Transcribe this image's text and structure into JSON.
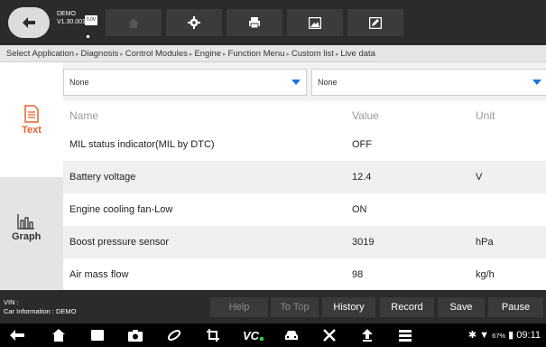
{
  "topbar": {
    "demo_label": "DEMO",
    "version": "V1.30.001",
    "voltage_badge": "0.0V",
    "icons": [
      "back-icon",
      "home-icon",
      "gear-icon",
      "printer-icon",
      "image-icon",
      "edit-icon"
    ]
  },
  "breadcrumb": {
    "items": [
      "Select Application",
      "Diagnosis",
      "Control Modules",
      "Engine",
      "Function Menu",
      "Custom list",
      "Live data"
    ]
  },
  "sidebar": {
    "text_label": "Text",
    "graph_label": "Graph"
  },
  "selects": {
    "left_value": "None",
    "right_value": "None"
  },
  "table": {
    "headers": [
      "Name",
      "Value",
      "Unit"
    ],
    "rows": [
      {
        "name": "MIL status indicator(MIL by DTC)",
        "value": "OFF",
        "unit": ""
      },
      {
        "name": "Battery voltage",
        "value": "12.4",
        "unit": "V"
      },
      {
        "name": "Engine cooling fan-Low",
        "value": "ON",
        "unit": ""
      },
      {
        "name": "Boost pressure sensor",
        "value": "3019",
        "unit": "hPa"
      },
      {
        "name": "Air mass flow",
        "value": "98",
        "unit": "kg/h"
      }
    ]
  },
  "actionbar": {
    "vin_label": "VIN :",
    "car_info": "Car Information : DEMO",
    "buttons": {
      "help": "Help",
      "to_top": "To Top",
      "history": "History",
      "record": "Record",
      "save": "Save",
      "pause": "Pause"
    }
  },
  "statusbar": {
    "battery_pct": "67%",
    "time": "09:11"
  },
  "colors": {
    "accent": "#1e73d8",
    "text_icon": "#e8622c",
    "dark_bar": "#2b2b2b"
  }
}
